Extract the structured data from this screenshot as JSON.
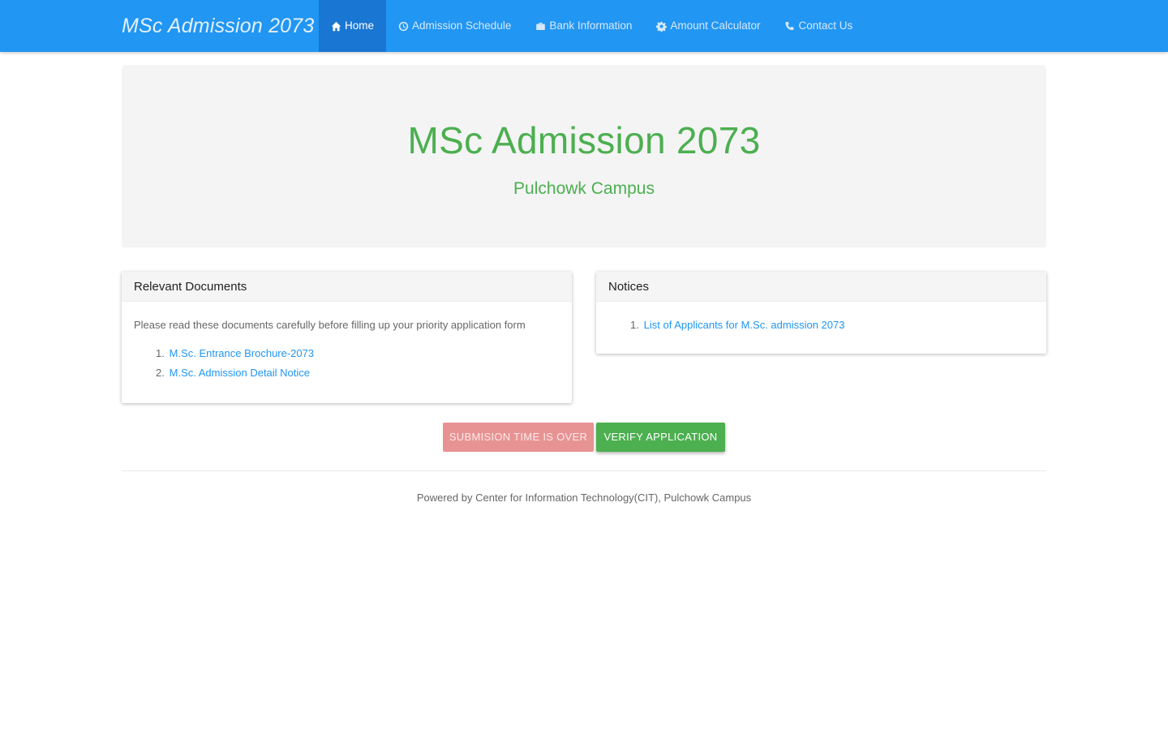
{
  "navbar": {
    "brand": "MSc Admission 2073",
    "items": [
      {
        "label": "Home",
        "icon": "home-icon",
        "active": true
      },
      {
        "label": "Admission Schedule",
        "icon": "clock-icon",
        "active": false
      },
      {
        "label": "Bank Information",
        "icon": "briefcase-icon",
        "active": false
      },
      {
        "label": "Amount Calculator",
        "icon": "gear-icon",
        "active": false
      },
      {
        "label": "Contact Us",
        "icon": "phone-icon",
        "active": false
      }
    ]
  },
  "jumbotron": {
    "title": "MSc Admission 2073",
    "subtitle": "Pulchowk Campus"
  },
  "documents": {
    "heading": "Relevant Documents",
    "intro": "Please read these documents carefully before filling up your priority application form",
    "items": [
      {
        "num": "1.",
        "label": "M.Sc. Entrance Brochure-2073"
      },
      {
        "num": "2.",
        "label": "M.Sc. Admission Detail Notice"
      }
    ]
  },
  "notices": {
    "heading": "Notices",
    "items": [
      {
        "num": "1.",
        "label": "List of Applicants for M.Sc. admission 2073"
      }
    ]
  },
  "buttons": {
    "submission": "SUBMISION TIME IS OVER",
    "verify": "VERIFY APPLICATION"
  },
  "footer": "Powered by Center for Information Technology(CIT), Pulchowk Campus",
  "colors": {
    "navbar": "#2196f3",
    "nav_active": "#1976d2",
    "accent_green": "#4caf50",
    "link_blue": "#2196f3",
    "disabled_red": "#e89393"
  }
}
